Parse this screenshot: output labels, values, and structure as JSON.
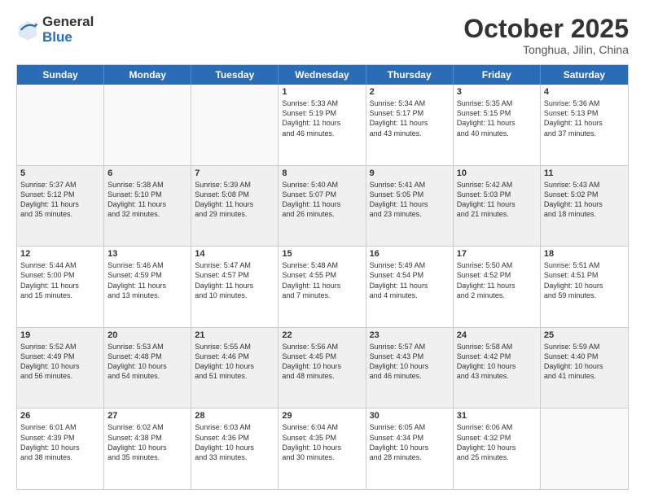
{
  "logo": {
    "general": "General",
    "blue": "Blue"
  },
  "title": "October 2025",
  "location": "Tonghua, Jilin, China",
  "header_days": [
    "Sunday",
    "Monday",
    "Tuesday",
    "Wednesday",
    "Thursday",
    "Friday",
    "Saturday"
  ],
  "weeks": [
    [
      {
        "day": "",
        "lines": [],
        "empty": true
      },
      {
        "day": "",
        "lines": [],
        "empty": true
      },
      {
        "day": "",
        "lines": [],
        "empty": true
      },
      {
        "day": "1",
        "lines": [
          "Sunrise: 5:33 AM",
          "Sunset: 5:19 PM",
          "Daylight: 11 hours",
          "and 46 minutes."
        ]
      },
      {
        "day": "2",
        "lines": [
          "Sunrise: 5:34 AM",
          "Sunset: 5:17 PM",
          "Daylight: 11 hours",
          "and 43 minutes."
        ]
      },
      {
        "day": "3",
        "lines": [
          "Sunrise: 5:35 AM",
          "Sunset: 5:15 PM",
          "Daylight: 11 hours",
          "and 40 minutes."
        ]
      },
      {
        "day": "4",
        "lines": [
          "Sunrise: 5:36 AM",
          "Sunset: 5:13 PM",
          "Daylight: 11 hours",
          "and 37 minutes."
        ]
      }
    ],
    [
      {
        "day": "5",
        "lines": [
          "Sunrise: 5:37 AM",
          "Sunset: 5:12 PM",
          "Daylight: 11 hours",
          "and 35 minutes."
        ]
      },
      {
        "day": "6",
        "lines": [
          "Sunrise: 5:38 AM",
          "Sunset: 5:10 PM",
          "Daylight: 11 hours",
          "and 32 minutes."
        ]
      },
      {
        "day": "7",
        "lines": [
          "Sunrise: 5:39 AM",
          "Sunset: 5:08 PM",
          "Daylight: 11 hours",
          "and 29 minutes."
        ]
      },
      {
        "day": "8",
        "lines": [
          "Sunrise: 5:40 AM",
          "Sunset: 5:07 PM",
          "Daylight: 11 hours",
          "and 26 minutes."
        ]
      },
      {
        "day": "9",
        "lines": [
          "Sunrise: 5:41 AM",
          "Sunset: 5:05 PM",
          "Daylight: 11 hours",
          "and 23 minutes."
        ]
      },
      {
        "day": "10",
        "lines": [
          "Sunrise: 5:42 AM",
          "Sunset: 5:03 PM",
          "Daylight: 11 hours",
          "and 21 minutes."
        ]
      },
      {
        "day": "11",
        "lines": [
          "Sunrise: 5:43 AM",
          "Sunset: 5:02 PM",
          "Daylight: 11 hours",
          "and 18 minutes."
        ]
      }
    ],
    [
      {
        "day": "12",
        "lines": [
          "Sunrise: 5:44 AM",
          "Sunset: 5:00 PM",
          "Daylight: 11 hours",
          "and 15 minutes."
        ]
      },
      {
        "day": "13",
        "lines": [
          "Sunrise: 5:46 AM",
          "Sunset: 4:59 PM",
          "Daylight: 11 hours",
          "and 13 minutes."
        ]
      },
      {
        "day": "14",
        "lines": [
          "Sunrise: 5:47 AM",
          "Sunset: 4:57 PM",
          "Daylight: 11 hours",
          "and 10 minutes."
        ]
      },
      {
        "day": "15",
        "lines": [
          "Sunrise: 5:48 AM",
          "Sunset: 4:55 PM",
          "Daylight: 11 hours",
          "and 7 minutes."
        ]
      },
      {
        "day": "16",
        "lines": [
          "Sunrise: 5:49 AM",
          "Sunset: 4:54 PM",
          "Daylight: 11 hours",
          "and 4 minutes."
        ]
      },
      {
        "day": "17",
        "lines": [
          "Sunrise: 5:50 AM",
          "Sunset: 4:52 PM",
          "Daylight: 11 hours",
          "and 2 minutes."
        ]
      },
      {
        "day": "18",
        "lines": [
          "Sunrise: 5:51 AM",
          "Sunset: 4:51 PM",
          "Daylight: 10 hours",
          "and 59 minutes."
        ]
      }
    ],
    [
      {
        "day": "19",
        "lines": [
          "Sunrise: 5:52 AM",
          "Sunset: 4:49 PM",
          "Daylight: 10 hours",
          "and 56 minutes."
        ]
      },
      {
        "day": "20",
        "lines": [
          "Sunrise: 5:53 AM",
          "Sunset: 4:48 PM",
          "Daylight: 10 hours",
          "and 54 minutes."
        ]
      },
      {
        "day": "21",
        "lines": [
          "Sunrise: 5:55 AM",
          "Sunset: 4:46 PM",
          "Daylight: 10 hours",
          "and 51 minutes."
        ]
      },
      {
        "day": "22",
        "lines": [
          "Sunrise: 5:56 AM",
          "Sunset: 4:45 PM",
          "Daylight: 10 hours",
          "and 48 minutes."
        ]
      },
      {
        "day": "23",
        "lines": [
          "Sunrise: 5:57 AM",
          "Sunset: 4:43 PM",
          "Daylight: 10 hours",
          "and 46 minutes."
        ]
      },
      {
        "day": "24",
        "lines": [
          "Sunrise: 5:58 AM",
          "Sunset: 4:42 PM",
          "Daylight: 10 hours",
          "and 43 minutes."
        ]
      },
      {
        "day": "25",
        "lines": [
          "Sunrise: 5:59 AM",
          "Sunset: 4:40 PM",
          "Daylight: 10 hours",
          "and 41 minutes."
        ]
      }
    ],
    [
      {
        "day": "26",
        "lines": [
          "Sunrise: 6:01 AM",
          "Sunset: 4:39 PM",
          "Daylight: 10 hours",
          "and 38 minutes."
        ]
      },
      {
        "day": "27",
        "lines": [
          "Sunrise: 6:02 AM",
          "Sunset: 4:38 PM",
          "Daylight: 10 hours",
          "and 35 minutes."
        ]
      },
      {
        "day": "28",
        "lines": [
          "Sunrise: 6:03 AM",
          "Sunset: 4:36 PM",
          "Daylight: 10 hours",
          "and 33 minutes."
        ]
      },
      {
        "day": "29",
        "lines": [
          "Sunrise: 6:04 AM",
          "Sunset: 4:35 PM",
          "Daylight: 10 hours",
          "and 30 minutes."
        ]
      },
      {
        "day": "30",
        "lines": [
          "Sunrise: 6:05 AM",
          "Sunset: 4:34 PM",
          "Daylight: 10 hours",
          "and 28 minutes."
        ]
      },
      {
        "day": "31",
        "lines": [
          "Sunrise: 6:06 AM",
          "Sunset: 4:32 PM",
          "Daylight: 10 hours",
          "and 25 minutes."
        ]
      },
      {
        "day": "",
        "lines": [],
        "empty": true
      }
    ]
  ]
}
